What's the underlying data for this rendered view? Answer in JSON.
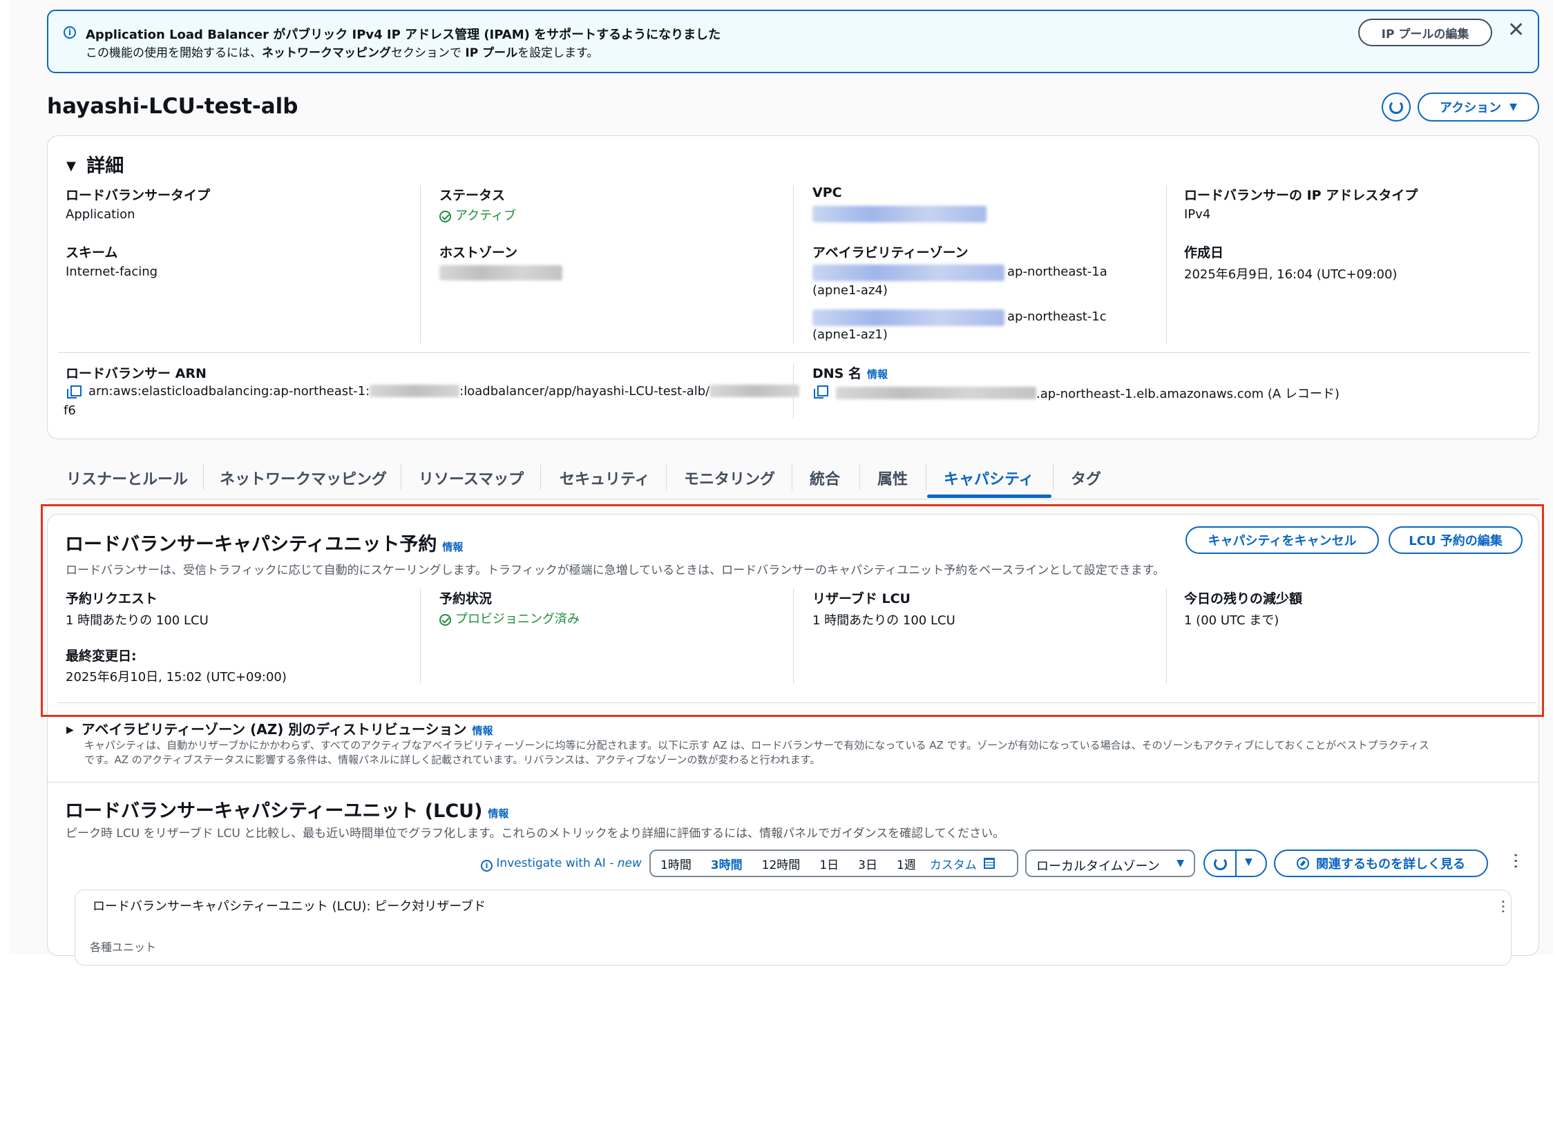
{
  "banner": {
    "title": "Application Load Balancer がパブリック IPv4 IP アドレス管理 (IPAM) をサポートするようになりました",
    "desc_prefix": "この機能の使用を開始するには、",
    "desc_link": "ネットワークマッピング",
    "desc_mid": "セクションで ",
    "desc_bold": "IP プール",
    "desc_suffix": "を設定します。",
    "button": "IP プールの編集"
  },
  "page": {
    "title": "hayashi-LCU-test-alb",
    "actions": "アクション"
  },
  "details": {
    "heading": "詳細",
    "lb_type_label": "ロードバランサータイプ",
    "lb_type_value": "Application",
    "scheme_label": "スキーム",
    "scheme_value": "Internet-facing",
    "status_label": "ステータス",
    "status_value": "アクティブ",
    "hosted_zone_label": "ホストゾーン",
    "vpc_label": "VPC",
    "az_label": "アベイラビリティーゾーン",
    "az1_name": "ap-northeast-1a",
    "az1_id": "(apne1-az4)",
    "az2_name": "ap-northeast-1c",
    "az2_id": "(apne1-az1)",
    "ip_type_label": "ロードバランサーの IP アドレスタイプ",
    "ip_type_value": "IPv4",
    "created_label": "作成日",
    "created_value": "2025年6月9日, 16:04 (UTC+09:00)",
    "arn_label": "ロードバランサー ARN",
    "arn_prefix": "arn:aws:elasticloadbalancing:ap-northeast-1:",
    "arn_mid": ":loadbalancer/app/hayashi-LCU-test-alb/",
    "arn_tail": "f6",
    "dns_label": "DNS 名",
    "dns_info": "情報",
    "dns_suffix": ".ap-northeast-1.elb.amazonaws.com (A レコード)"
  },
  "tabs": [
    "リスナーとルール",
    "ネットワークマッピング",
    "リソースマップ",
    "セキュリティ",
    "モニタリング",
    "統合",
    "属性",
    "キャパシティ",
    "タグ"
  ],
  "capacity": {
    "title": "ロードバランサーキャパシティユニット予約",
    "info": "情報",
    "desc": "ロードバランサーは、受信トラフィックに応じて自動的にスケーリングします。トラフィックが極端に急増しているときは、ロードバランサーのキャパシティユニット予約をベースラインとして設定できます。",
    "cancel_button": "キャパシティをキャンセル",
    "edit_button": "LCU 予約の編集",
    "req_label": "予約リクエスト",
    "req_value": "1 時間あたりの 100 LCU",
    "last_mod_label": "最終変更日:",
    "last_mod_value": "2025年6月10日, 15:02 (UTC+09:00)",
    "state_label": "予約状況",
    "state_value": "プロビジョニング済み",
    "reserved_label": "リザーブド LCU",
    "reserved_value": "1 時間あたりの 100 LCU",
    "remaining_label": "今日の残りの減少額",
    "remaining_value": "1 (00 UTC まで)"
  },
  "az_dist": {
    "title": "アベイラビリティーゾーン (AZ) 別のディストリビューション",
    "info": "情報",
    "desc1": "キャパシティは、自動かリザーブかにかかわらず、すべてのアクティブなアベイラビリティーゾーンに均等に分配されます。以下に示す AZ は、ロードバランサーで有効になっている AZ です。ゾーンが有効になっている場合は、そのゾーンもアクティブにしておくことがベストプラクティス",
    "desc2": "です。AZ のアクティブステータスに影響する条件は、情報パネルに詳しく記載されています。リバランスは、アクティブなゾーンの数が変わると行われます。"
  },
  "lcu": {
    "title": "ロードバランサーキャパシティーユニット (LCU)",
    "info": "情報",
    "desc": "ピーク時 LCU をリザーブド LCU と比較し、最も近い時間単位でグラフ化します。これらのメトリックをより詳細に評価するには、情報パネルでガイダンスを確認してください。",
    "investigate": "Investigate with AI",
    "investigate_new": "- new",
    "ranges": [
      "1時間",
      "3時間",
      "12時間",
      "1日",
      "3日",
      "1週"
    ],
    "custom": "カスタム",
    "timezone": "ローカルタイムゾーン",
    "explore": "関連するものを詳しく見る",
    "chart_title": "ロードバランサーキャパシティーユニット (LCU): ピーク対リザーブド",
    "chart_ylabel": "各種ユニット"
  },
  "colors": {
    "accent": "#0a66c2",
    "highlight": "#e0351b",
    "success": "#1f8d3b"
  }
}
